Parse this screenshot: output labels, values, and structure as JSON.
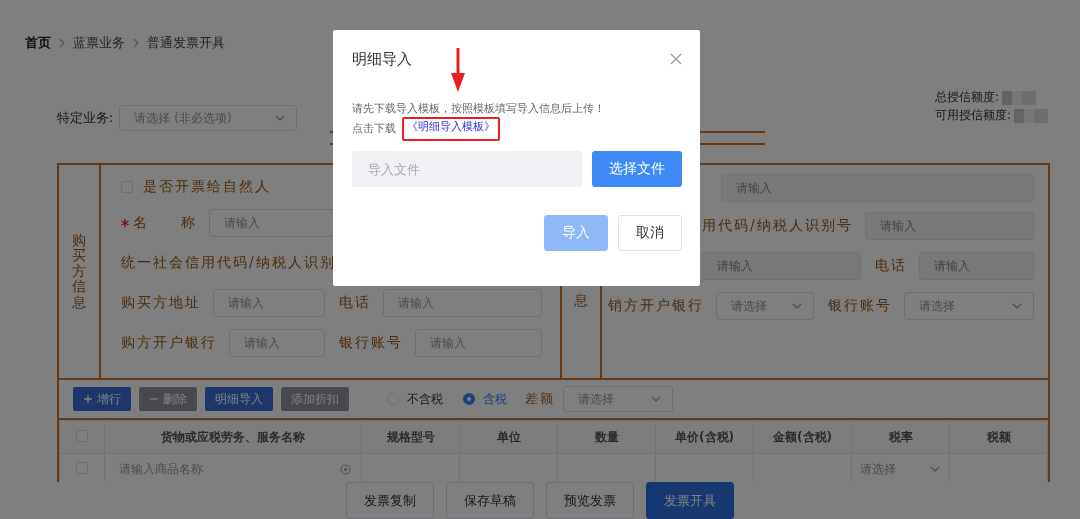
{
  "breadcrumb": [
    {
      "label": "首页"
    },
    {
      "label": "蓝票业务"
    },
    {
      "label": "普通发票开具"
    }
  ],
  "special_business": {
    "label": "特定业务:",
    "placeholder": "请选择 (非必选项)"
  },
  "credit": [
    {
      "label": "总授信额度:"
    },
    {
      "label": "可用授信额度:"
    }
  ],
  "buyer": {
    "title": "购买方信息",
    "natural_person": {
      "label": "是否开票给自然人",
      "checked": false
    },
    "rows": [
      [
        {
          "label": "名　　称",
          "required": true,
          "kind": "input",
          "placeholder": "请输入"
        }
      ],
      [
        {
          "label": "统一社会信用代码/纳税人识别",
          "kind": "label"
        }
      ],
      [
        {
          "label": "购买方地址",
          "kind": "input",
          "placeholder": "请输入"
        },
        {
          "label": "电话",
          "kind": "input",
          "placeholder": "请输入"
        }
      ],
      [
        {
          "label": "购方开户银行",
          "kind": "input",
          "placeholder": "请输入"
        },
        {
          "label": "银行账号",
          "kind": "input",
          "placeholder": "请输入"
        }
      ]
    ]
  },
  "seller": {
    "title": "息",
    "rows": [
      [
        {
          "kind": "input",
          "placeholder": "请输入",
          "disabled": true
        }
      ],
      [
        {
          "label": "用代码/纳税人识别号",
          "kind": "input",
          "placeholder": "请输入",
          "disabled": true
        }
      ],
      [
        {
          "kind": "input",
          "placeholder": "请输入",
          "disabled": true
        },
        {
          "label": "电话",
          "kind": "input",
          "placeholder": "请输入",
          "disabled": true
        }
      ],
      [
        {
          "label": "销方开户银行",
          "kind": "select",
          "placeholder": "请选择"
        },
        {
          "label": "银行账号",
          "kind": "select",
          "placeholder": "请选择"
        }
      ]
    ]
  },
  "toolbar": {
    "buttons": [
      {
        "label": "增行",
        "kind": "add",
        "disabled": false
      },
      {
        "label": "删除",
        "kind": "remove",
        "disabled": true
      },
      {
        "label": "明细导入",
        "kind": "plain",
        "disabled": false
      },
      {
        "label": "添加折扣",
        "kind": "plain",
        "disabled": true
      }
    ],
    "tax_mode": [
      {
        "label": "不含税",
        "selected": false
      },
      {
        "label": "含税",
        "selected": true
      }
    ],
    "difference": {
      "label": "差额",
      "placeholder": "请选择"
    }
  },
  "table": {
    "select_all_checked": false,
    "columns": [
      "货物或应税劳务、服务名称",
      "规格型号",
      "单位",
      "数量",
      "单价(含税)",
      "金额(含税)",
      "税率",
      "税额"
    ],
    "rows": [
      {
        "name_placeholder": "请输入商品名称",
        "tax_rate_placeholder": "请选择",
        "checked": false
      }
    ]
  },
  "footer_buttons": [
    {
      "label": "发票复制",
      "primary": false
    },
    {
      "label": "保存草稿",
      "primary": false
    },
    {
      "label": "预览发票",
      "primary": false
    },
    {
      "label": "发票开具",
      "primary": true
    }
  ],
  "dialog": {
    "title": "明细导入",
    "instructions": "请先下载导入模板，按照模板填写导入信息后上传！",
    "download_prefix": "点击下载",
    "download_link": "《明细导入模板》",
    "file_placeholder": "导入文件",
    "choose_button": "选择文件",
    "buttons": [
      {
        "label": "导入",
        "primary": true,
        "disabled": true
      },
      {
        "label": "取消",
        "primary": false,
        "disabled": false
      }
    ]
  }
}
